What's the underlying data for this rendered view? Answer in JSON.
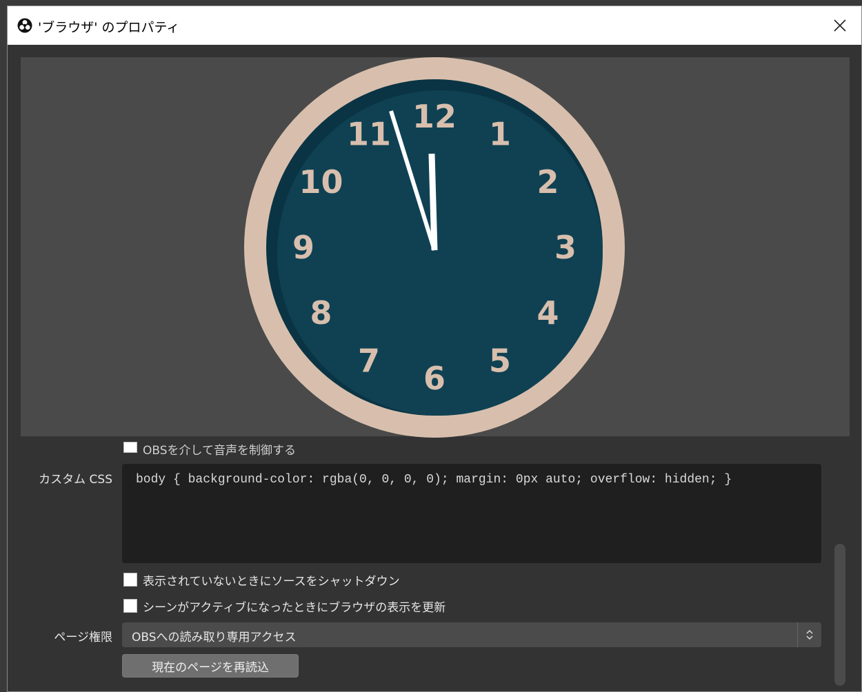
{
  "window": {
    "title": "'ブラウザ' のプロパティ",
    "close_symbol": "×"
  },
  "colors": {
    "titlebar_bg": "#ffffff",
    "window_bg": "#333333",
    "preview_bg": "#4a4a4a",
    "clock_rim": "#d8bfad",
    "clock_face": "#0f4153",
    "clock_numbers": "#d8bfad",
    "clock_hands": "#ffffff",
    "editor_bg": "#1f1f1f"
  },
  "preview": {
    "clock": {
      "numbers": [
        "12",
        "1",
        "2",
        "3",
        "4",
        "5",
        "6",
        "7",
        "8",
        "9",
        "10",
        "11"
      ],
      "time": "11:56"
    }
  },
  "settings": {
    "obs_audio_checkbox_label": "OBSを介して音声を制御する",
    "custom_css_label": "カスタム CSS",
    "custom_css_value": "body { background-color: rgba(0, 0, 0, 0); margin: 0px auto; overflow: hidden; }",
    "shutdown_checkbox_label": "表示されていないときにソースをシャットダウン",
    "refresh_checkbox_label": "シーンがアクティブになったときにブラウザの表示を更新",
    "page_permissions_label": "ページ権限",
    "page_permissions_value": "OBSへの読み取り専用アクセス",
    "reload_button_label": "現在のページを再読込"
  },
  "icons": {
    "app": "obs-logo-icon",
    "close": "close-icon",
    "select_arrows": "chevron-up-down-icon"
  }
}
